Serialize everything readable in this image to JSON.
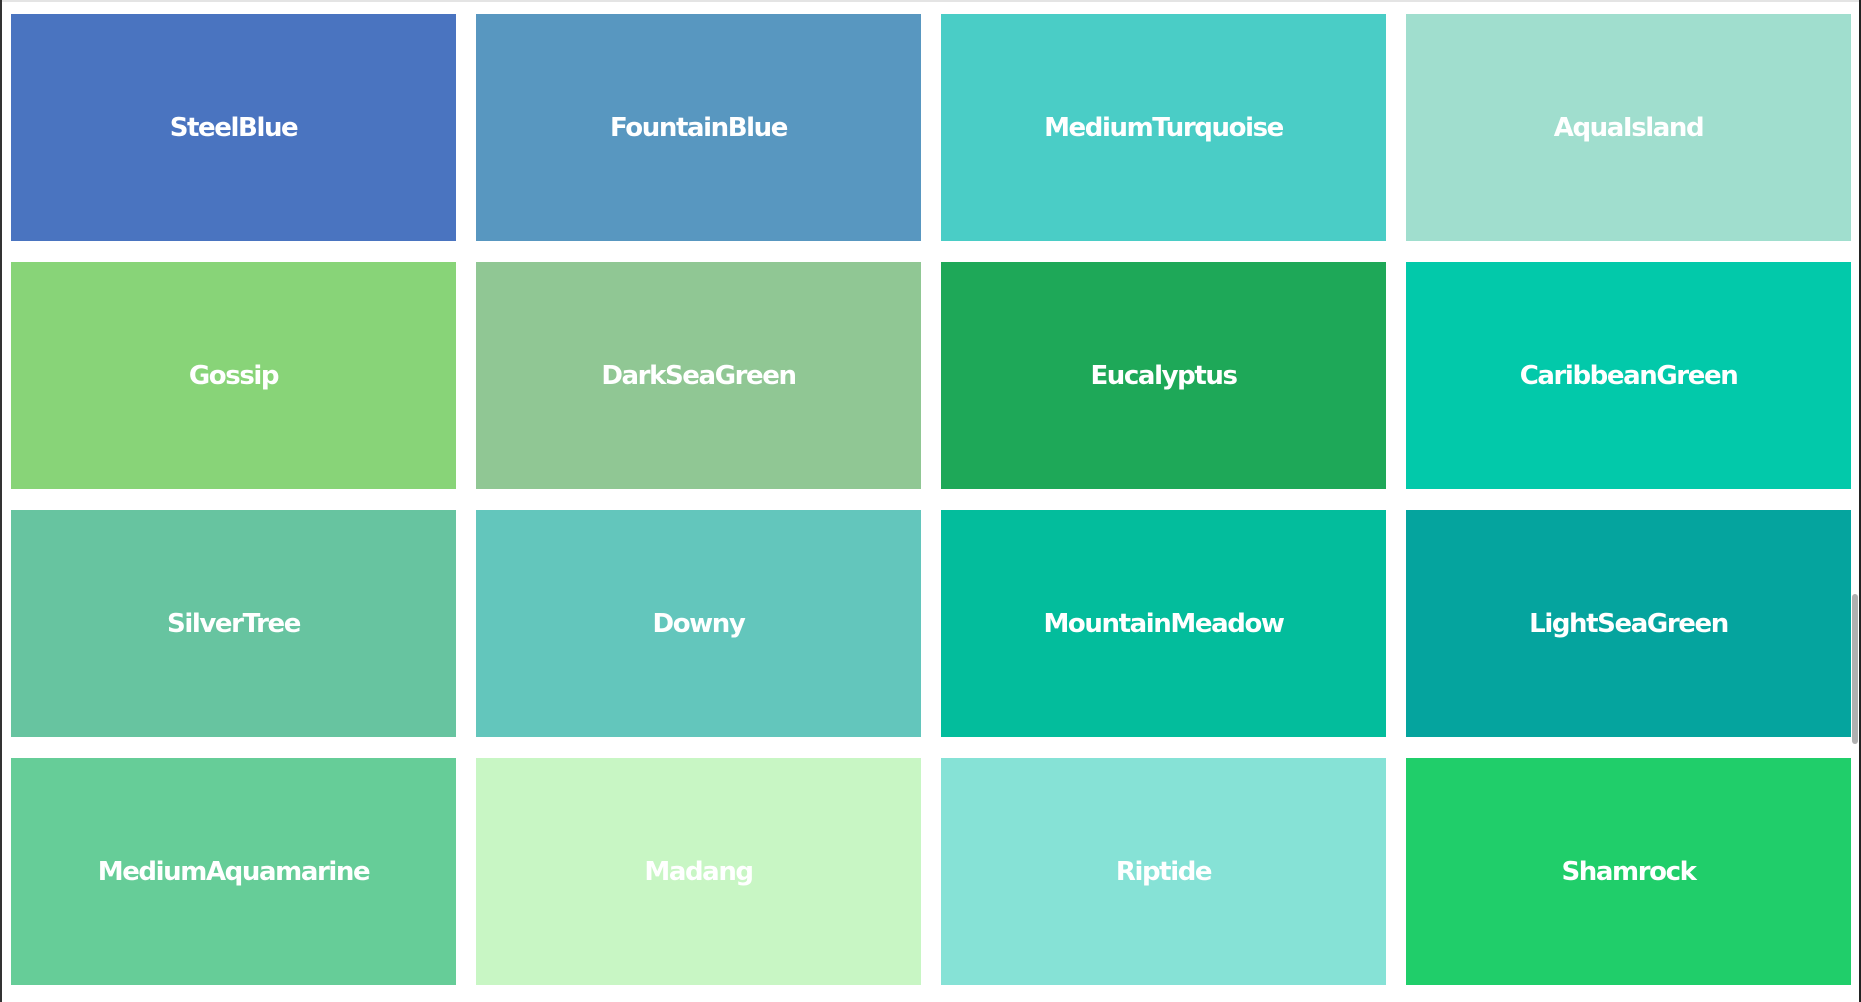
{
  "tiles": [
    {
      "name": "SteelBlue",
      "color": "#4a74c0"
    },
    {
      "name": "FountainBlue",
      "color": "#5897c0"
    },
    {
      "name": "MediumTurquoise",
      "color": "#4acdc6"
    },
    {
      "name": "AquaIsland",
      "color": "#a0dece"
    },
    {
      "name": "Gossip",
      "color": "#88d478"
    },
    {
      "name": "DarkSeaGreen",
      "color": "#90c794"
    },
    {
      "name": "Eucalyptus",
      "color": "#1ea858"
    },
    {
      "name": "CaribbeanGreen",
      "color": "#02c9aa"
    },
    {
      "name": "SilverTree",
      "color": "#67c4a0"
    },
    {
      "name": "Downy",
      "color": "#63c6bc"
    },
    {
      "name": "MountainMeadow",
      "color": "#03bd9c"
    },
    {
      "name": "LightSeaGreen",
      "color": "#05a49e"
    },
    {
      "name": "MediumAquamarine",
      "color": "#66cd98"
    },
    {
      "name": "Madang",
      "color": "#c8f6c4"
    },
    {
      "name": "Riptide",
      "color": "#86e2d6"
    },
    {
      "name": "Shamrock",
      "color": "#20ce6a"
    }
  ],
  "scrollbar": {
    "position_fraction": 0.75
  }
}
